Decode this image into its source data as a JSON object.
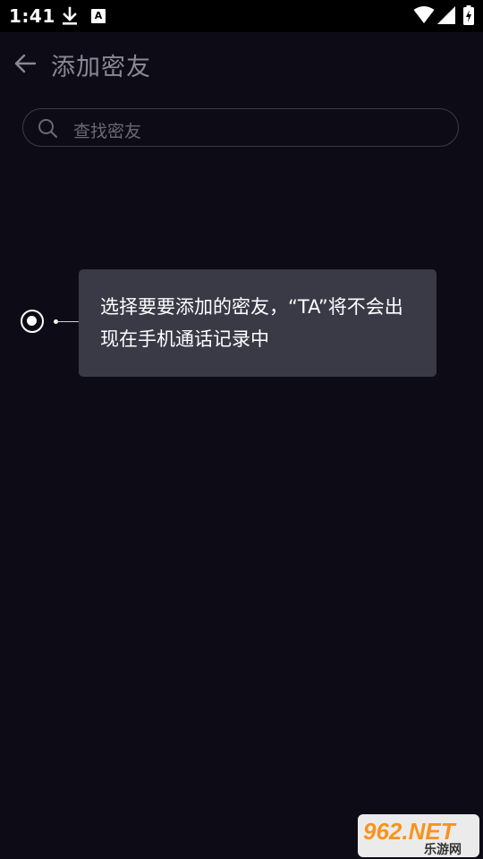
{
  "status_bar": {
    "time": "1:41",
    "app_badge": "A"
  },
  "header": {
    "title": "添加密友"
  },
  "search": {
    "placeholder": "查找密友"
  },
  "guide": {
    "tip_text": "选择要要添加的密友，“TA”将不会出现在手机通话记录中"
  },
  "watermark": {
    "brand": "962.NET",
    "subtitle": "乐游网"
  },
  "colors": {
    "background": "#0d0c16",
    "tooltip": "#3a3a47",
    "title_text": "#8a8896",
    "placeholder_text": "#6a6876",
    "watermark_orange": "#f7941d"
  },
  "icons": [
    "download-icon",
    "wifi-icon",
    "signal-icon",
    "battery-icon",
    "back-arrow-icon",
    "search-icon"
  ]
}
